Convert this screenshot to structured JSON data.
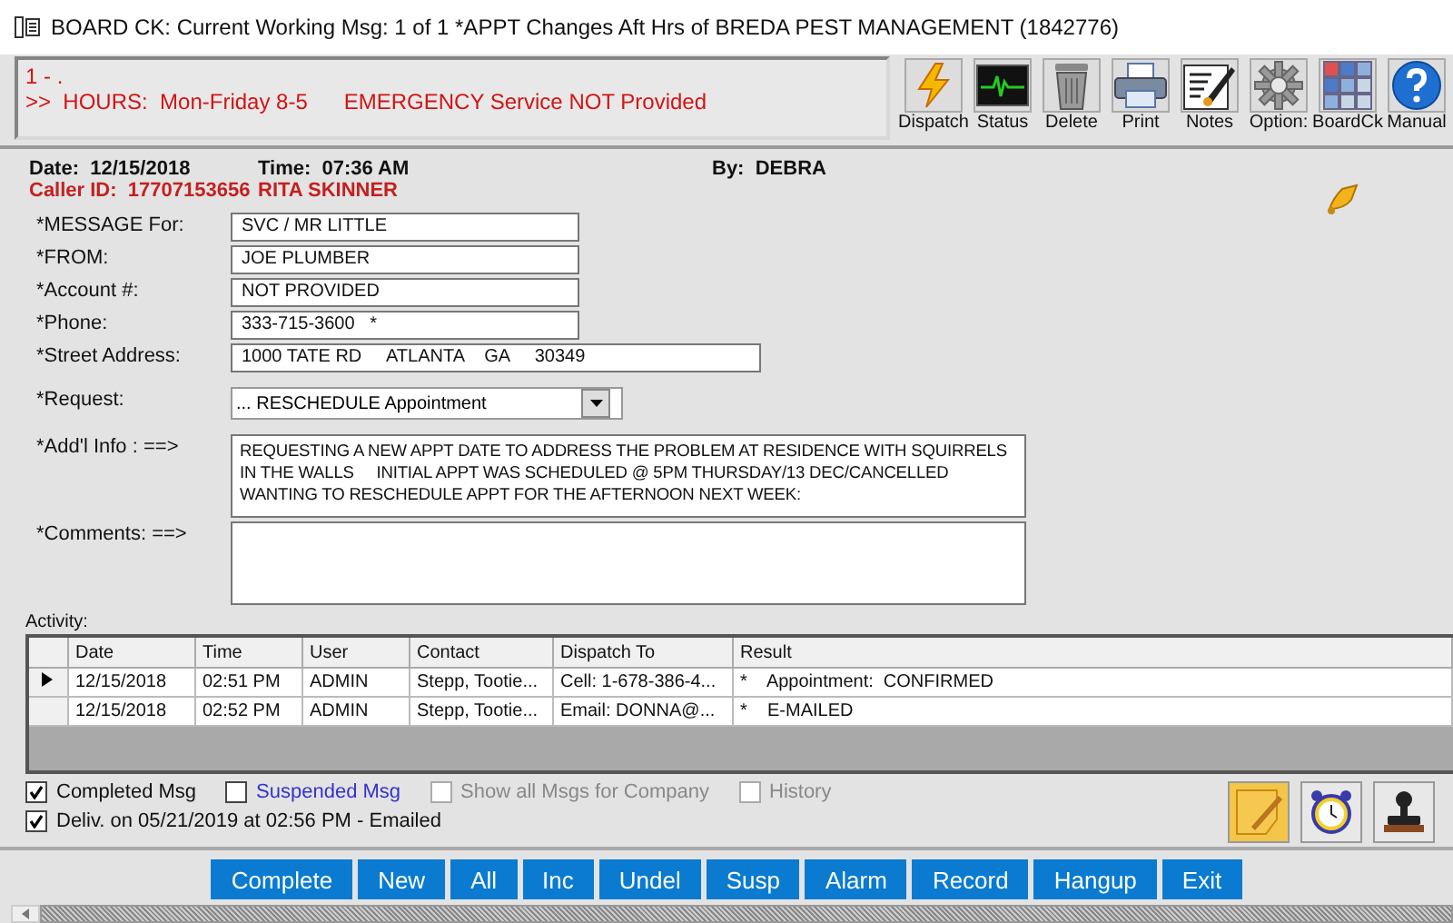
{
  "window": {
    "title": "BOARD CK: Current Working Msg: 1 of 1 *APPT Changes Aft Hrs of BREDA PEST MANAGEMENT (1842776)"
  },
  "notice": {
    "lines": [
      "1 - .",
      ">>  HOURS:  Mon-Friday 8-5      EMERGENCY Service NOT Provided"
    ]
  },
  "toolbar": [
    {
      "kind": "dispatch",
      "label": "Dispatch"
    },
    {
      "kind": "status",
      "label": "Status"
    },
    {
      "kind": "delete",
      "label": "Delete"
    },
    {
      "kind": "print",
      "label": "Print"
    },
    {
      "kind": "notes",
      "label": "Notes"
    },
    {
      "kind": "options",
      "label": "Option:"
    },
    {
      "kind": "boardck",
      "label": "BoardCk"
    },
    {
      "kind": "manual",
      "label": "Manual"
    }
  ],
  "info": {
    "date_label": "Date:",
    "date": "12/15/2018",
    "time_label": "Time:",
    "time": "07:36 AM",
    "by_label": "By:",
    "by": "DEBRA",
    "caller_label": "Caller ID:",
    "caller_id": "17707153656",
    "caller_name": "RITA SKINNER"
  },
  "fields": [
    {
      "kind": "text",
      "label": "*MESSAGE For:",
      "value": "SVC / MR LITTLE"
    },
    {
      "kind": "text",
      "label": "*FROM:",
      "value": "JOE PLUMBER"
    },
    {
      "kind": "text",
      "label": "*Account #:",
      "value": "NOT PROVIDED"
    },
    {
      "kind": "text",
      "label": "*Phone:",
      "value": "333-715-3600   *"
    },
    {
      "kind": "wide",
      "label": "*Street Address:",
      "value": "1000 TATE RD     ATLANTA    GA     30349"
    },
    {
      "kind": "dropdown",
      "label": "*Request:",
      "value": "... RESCHEDULE Appointment"
    },
    {
      "kind": "area",
      "label": "*Add'l Info : ==>",
      "value": "REQUESTING A NEW APPT DATE TO ADDRESS THE PROBLEM AT RESIDENCE WITH SQUIRRELS IN THE WALLS     INITIAL APPT WAS SCHEDULED @ 5PM THURSDAY/13 DEC/CANCELLED     WANTING TO RESCHEDULE APPT FOR THE AFTERNOON NEXT WEEK:"
    },
    {
      "kind": "area",
      "label": "*Comments: ==>"
    }
  ],
  "activity": {
    "label": "Activity:",
    "columns": [
      "Date",
      "Time",
      "User",
      "Contact",
      "Dispatch To",
      "Result"
    ],
    "rows": [
      {
        "selected": true,
        "cells": [
          "12/15/2018",
          "02:51 PM",
          "ADMIN",
          "Stepp, Tootie...",
          "Cell: 1-678-386-4...",
          "*    Appointment:  CONFIRMED"
        ]
      },
      {
        "selected": false,
        "cells": [
          "12/15/2018",
          "02:52 PM",
          "ADMIN",
          "Stepp, Tootie...",
          "Email: DONNA@...",
          "*    E-MAILED"
        ]
      }
    ]
  },
  "options": [
    {
      "label": "Completed Msg",
      "checked": true,
      "disabled": false
    },
    {
      "label": "Suspended Msg",
      "checked": false,
      "disabled": false,
      "color": "#3333cc"
    },
    {
      "label": "Show all Msgs for Company",
      "checked": false,
      "disabled": true
    },
    {
      "label": "History",
      "checked": false,
      "disabled": true
    }
  ],
  "delivery": {
    "label": "Deliv. on 05/21/2019 at 02:56 PM - Emailed",
    "checked": true
  },
  "side_tools": [
    {
      "kind": "note"
    },
    {
      "kind": "alarm"
    },
    {
      "kind": "stamp"
    }
  ],
  "actions": [
    "Complete",
    "New",
    "All",
    "Inc",
    "Undel",
    "Susp",
    "Alarm",
    "Record",
    "Hangup",
    "Exit"
  ]
}
